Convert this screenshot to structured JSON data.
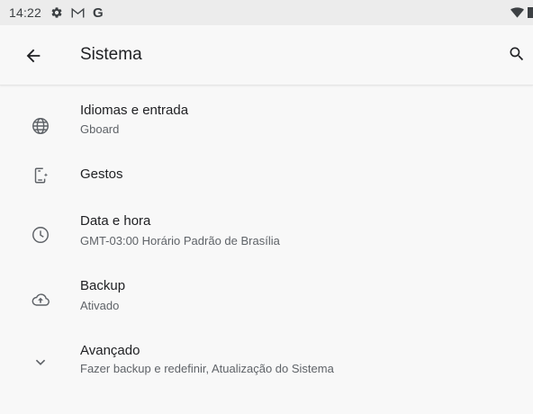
{
  "status_bar": {
    "time": "14:22",
    "notification_icons": [
      "settings-gear-icon",
      "gmail-icon",
      "google-g-icon"
    ],
    "google_letter": "G",
    "system_icons": [
      "wifi-icon",
      "battery-icon"
    ]
  },
  "app_bar": {
    "title": "Sistema",
    "back_icon": "arrow-back-icon",
    "search_icon": "search-icon"
  },
  "items": [
    {
      "icon": "globe-icon",
      "title": "Idiomas e entrada",
      "subtitle": "Gboard"
    },
    {
      "icon": "gestures-phone-icon",
      "title": "Gestos",
      "subtitle": ""
    },
    {
      "icon": "clock-icon",
      "title": "Data e hora",
      "subtitle": "GMT-03:00 Horário Padrão de Brasília"
    },
    {
      "icon": "cloud-upload-icon",
      "title": "Backup",
      "subtitle": "Ativado"
    },
    {
      "icon": "chevron-down-icon",
      "title": "Avançado",
      "subtitle": "Fazer backup e redefinir, Atualização do Sistema"
    }
  ],
  "colors": {
    "background": "#f8f8f8",
    "status_bar": "#ececec",
    "text_primary": "#202124",
    "text_secondary": "#5f6368",
    "icon": "#5f6368"
  }
}
